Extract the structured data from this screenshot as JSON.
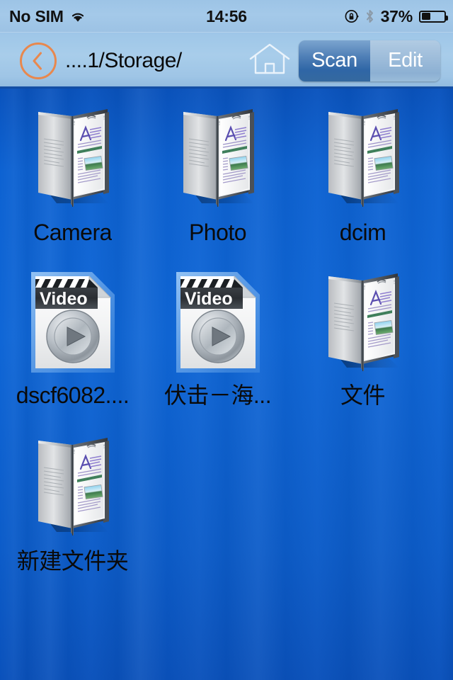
{
  "status_bar": {
    "carrier": "No SIM",
    "wifi_icon": "wifi-icon",
    "time": "14:56",
    "rotation_lock_icon": "rotation-lock-icon",
    "bluetooth_icon": "bluetooth-icon",
    "battery_percent": "37%",
    "battery_level": 37,
    "battery_icon": "battery-icon"
  },
  "nav_bar": {
    "back_icon": "chevron-left-icon",
    "path": "....1/Storage/",
    "home_icon": "home-icon",
    "segmented": {
      "scan_label": "Scan",
      "edit_label": "Edit",
      "selected": "Scan"
    }
  },
  "colors": {
    "background_blue": "#0d62d2",
    "nav_bar_blue": "#a3c9e8",
    "back_button_orange": "#e8884e",
    "segment_selected": "#2f66a6",
    "segment_unselected": "#9dbcda",
    "label_text": "#0a0a0a"
  },
  "files": [
    {
      "name": "Camera",
      "icon": "folder-book-icon"
    },
    {
      "name": "Photo",
      "icon": "folder-book-icon"
    },
    {
      "name": "dcim",
      "icon": "folder-book-icon"
    },
    {
      "name": "dscf6082....",
      "icon": "video-file-icon"
    },
    {
      "name": "伏击－海...",
      "icon": "video-file-icon"
    },
    {
      "name": "文件",
      "icon": "folder-book-icon"
    },
    {
      "name": "新建文件夹",
      "icon": "folder-book-icon"
    }
  ]
}
